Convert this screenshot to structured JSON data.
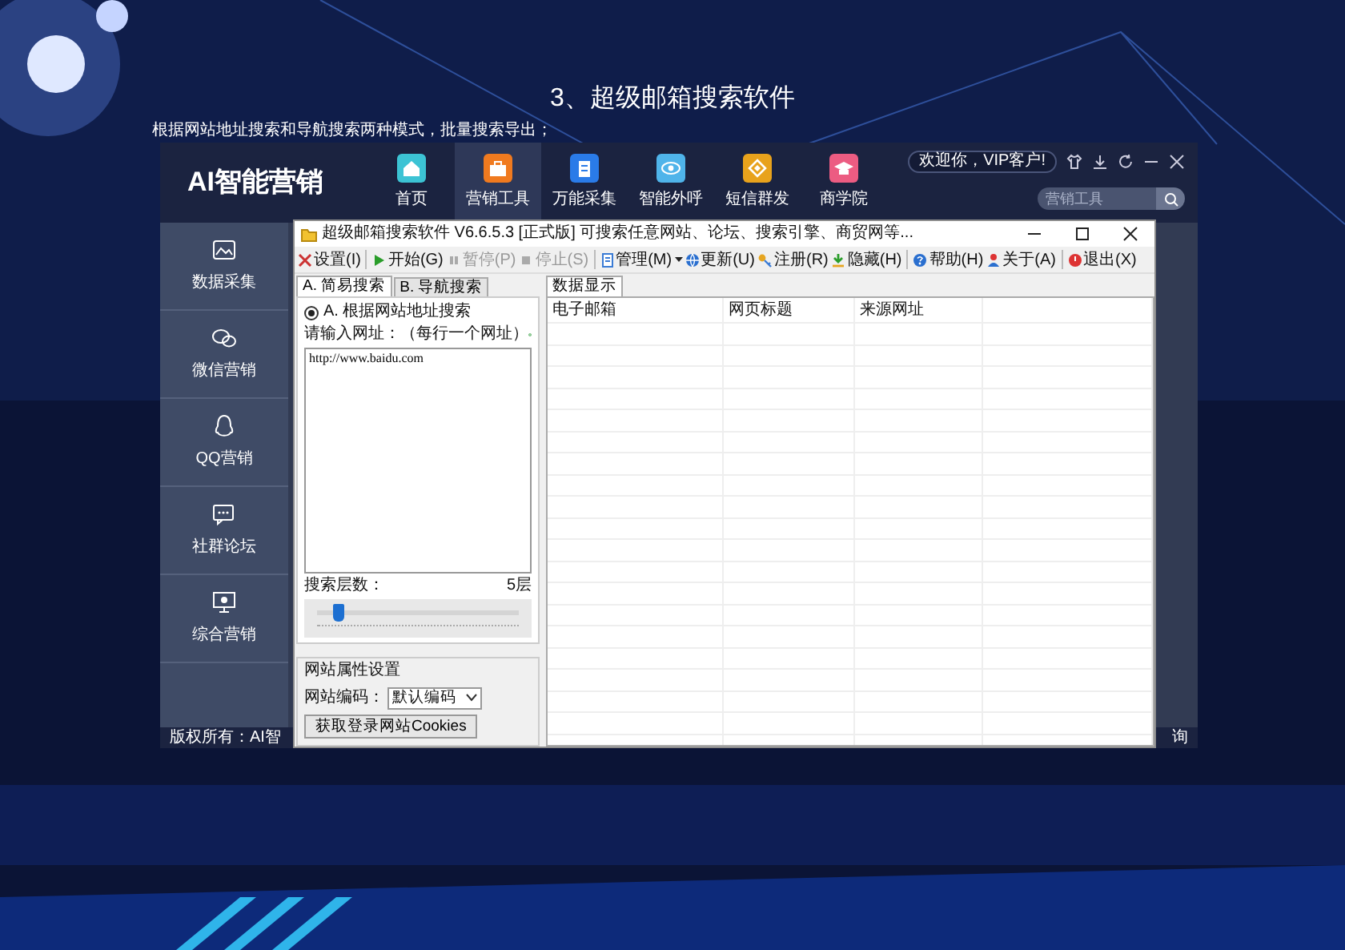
{
  "slide": {
    "title": "3、超级邮箱搜索软件",
    "subtitle": "根据网站地址搜索和导航搜索两种模式，批量搜索导出；"
  },
  "app": {
    "logo": "AI智能营销",
    "nav": [
      {
        "label": "首页",
        "color": "#3cc3d4",
        "selected": false
      },
      {
        "label": "营销工具",
        "color": "#f07a1f",
        "selected": true
      },
      {
        "label": "万能采集",
        "color": "#2a7be8",
        "selected": false
      },
      {
        "label": "智能外呼",
        "color": "#4fb4ea",
        "selected": false
      },
      {
        "label": "短信群发",
        "color": "#e8a21c",
        "selected": false
      },
      {
        "label": "商学院",
        "color": "#ec5c82",
        "selected": false
      }
    ],
    "welcome": "欢迎你，VIP客户!",
    "search": {
      "placeholder": "营销工具"
    },
    "sidebar": [
      {
        "label": "数据采集"
      },
      {
        "label": "微信营销"
      },
      {
        "label": "QQ营销"
      },
      {
        "label": "社群论坛"
      },
      {
        "label": "综合营销"
      }
    ],
    "status_bar": {
      "left": "版权所有：AI智",
      "right": "询"
    }
  },
  "window": {
    "title": "超级邮箱搜索软件 V6.6.5.3 [正式版] 可搜索任意网站、论坛、搜索引擎、商贸网等...",
    "toolbar": [
      {
        "label": "设置(I)",
        "disabled": false
      },
      {
        "label": "开始(G)",
        "disabled": false,
        "separator_before": true
      },
      {
        "label": "暂停(P)",
        "disabled": true
      },
      {
        "label": "停止(S)",
        "disabled": true
      },
      {
        "label": "管理(M)",
        "disabled": false,
        "separator_before": true,
        "has_menu": true
      },
      {
        "label": "更新(U)",
        "disabled": false
      },
      {
        "label": "注册(R)",
        "disabled": false
      },
      {
        "label": "隐藏(H)",
        "disabled": false
      },
      {
        "label": "帮助(H)",
        "disabled": false,
        "separator_before": true
      },
      {
        "label": "关于(A)",
        "disabled": false
      },
      {
        "label": "退出(X)",
        "disabled": false,
        "separator_before": true
      }
    ],
    "left_tabs": [
      {
        "label": "A. 简易搜索",
        "selected": true
      },
      {
        "label": "B. 导航搜索",
        "selected": false
      }
    ],
    "mode_radio": {
      "label": "A. 根据网站地址搜索",
      "checked": true
    },
    "url_label": "请输入网址：（每行一个网址）",
    "urls": "http://www.baidu.com",
    "depth": {
      "label": "搜索层数：",
      "reading": "5层",
      "level": 0.1
    },
    "site_settings": {
      "title": "网站属性设置",
      "encoding_label": "网站编码：",
      "encoding": "默认编码",
      "cookie_button": "获取登录网站Cookies"
    },
    "right_tabs": [
      {
        "label": "数据显示",
        "selected": true
      }
    ],
    "table": {
      "columns": [
        "电子邮箱",
        "网页标题",
        "来源网址"
      ]
    }
  }
}
